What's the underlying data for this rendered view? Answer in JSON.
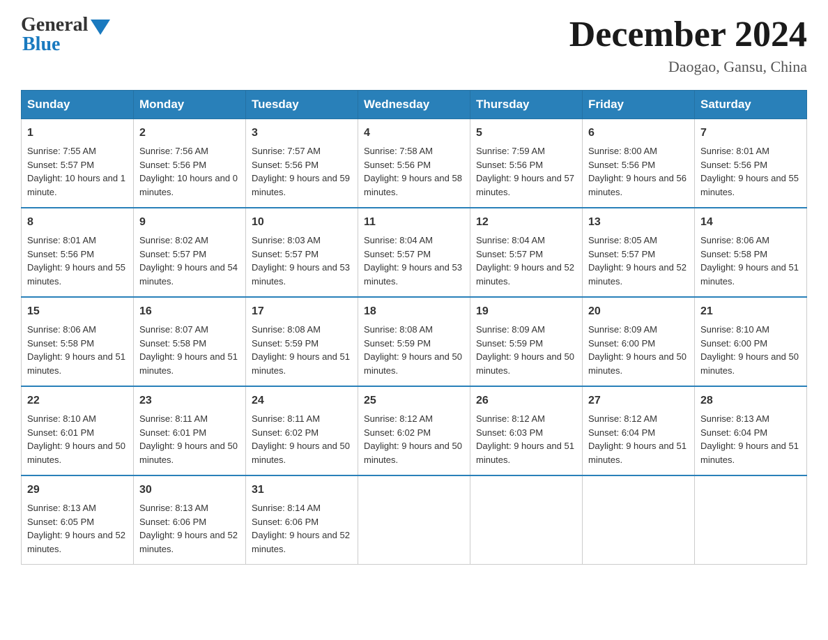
{
  "logo": {
    "general": "General",
    "blue": "Blue"
  },
  "title": "December 2024",
  "location": "Daogao, Gansu, China",
  "days_of_week": [
    "Sunday",
    "Monday",
    "Tuesday",
    "Wednesday",
    "Thursday",
    "Friday",
    "Saturday"
  ],
  "weeks": [
    [
      {
        "day": "1",
        "sunrise": "7:55 AM",
        "sunset": "5:57 PM",
        "daylight": "10 hours and 1 minute."
      },
      {
        "day": "2",
        "sunrise": "7:56 AM",
        "sunset": "5:56 PM",
        "daylight": "10 hours and 0 minutes."
      },
      {
        "day": "3",
        "sunrise": "7:57 AM",
        "sunset": "5:56 PM",
        "daylight": "9 hours and 59 minutes."
      },
      {
        "day": "4",
        "sunrise": "7:58 AM",
        "sunset": "5:56 PM",
        "daylight": "9 hours and 58 minutes."
      },
      {
        "day": "5",
        "sunrise": "7:59 AM",
        "sunset": "5:56 PM",
        "daylight": "9 hours and 57 minutes."
      },
      {
        "day": "6",
        "sunrise": "8:00 AM",
        "sunset": "5:56 PM",
        "daylight": "9 hours and 56 minutes."
      },
      {
        "day": "7",
        "sunrise": "8:01 AM",
        "sunset": "5:56 PM",
        "daylight": "9 hours and 55 minutes."
      }
    ],
    [
      {
        "day": "8",
        "sunrise": "8:01 AM",
        "sunset": "5:56 PM",
        "daylight": "9 hours and 55 minutes."
      },
      {
        "day": "9",
        "sunrise": "8:02 AM",
        "sunset": "5:57 PM",
        "daylight": "9 hours and 54 minutes."
      },
      {
        "day": "10",
        "sunrise": "8:03 AM",
        "sunset": "5:57 PM",
        "daylight": "9 hours and 53 minutes."
      },
      {
        "day": "11",
        "sunrise": "8:04 AM",
        "sunset": "5:57 PM",
        "daylight": "9 hours and 53 minutes."
      },
      {
        "day": "12",
        "sunrise": "8:04 AM",
        "sunset": "5:57 PM",
        "daylight": "9 hours and 52 minutes."
      },
      {
        "day": "13",
        "sunrise": "8:05 AM",
        "sunset": "5:57 PM",
        "daylight": "9 hours and 52 minutes."
      },
      {
        "day": "14",
        "sunrise": "8:06 AM",
        "sunset": "5:58 PM",
        "daylight": "9 hours and 51 minutes."
      }
    ],
    [
      {
        "day": "15",
        "sunrise": "8:06 AM",
        "sunset": "5:58 PM",
        "daylight": "9 hours and 51 minutes."
      },
      {
        "day": "16",
        "sunrise": "8:07 AM",
        "sunset": "5:58 PM",
        "daylight": "9 hours and 51 minutes."
      },
      {
        "day": "17",
        "sunrise": "8:08 AM",
        "sunset": "5:59 PM",
        "daylight": "9 hours and 51 minutes."
      },
      {
        "day": "18",
        "sunrise": "8:08 AM",
        "sunset": "5:59 PM",
        "daylight": "9 hours and 50 minutes."
      },
      {
        "day": "19",
        "sunrise": "8:09 AM",
        "sunset": "5:59 PM",
        "daylight": "9 hours and 50 minutes."
      },
      {
        "day": "20",
        "sunrise": "8:09 AM",
        "sunset": "6:00 PM",
        "daylight": "9 hours and 50 minutes."
      },
      {
        "day": "21",
        "sunrise": "8:10 AM",
        "sunset": "6:00 PM",
        "daylight": "9 hours and 50 minutes."
      }
    ],
    [
      {
        "day": "22",
        "sunrise": "8:10 AM",
        "sunset": "6:01 PM",
        "daylight": "9 hours and 50 minutes."
      },
      {
        "day": "23",
        "sunrise": "8:11 AM",
        "sunset": "6:01 PM",
        "daylight": "9 hours and 50 minutes."
      },
      {
        "day": "24",
        "sunrise": "8:11 AM",
        "sunset": "6:02 PM",
        "daylight": "9 hours and 50 minutes."
      },
      {
        "day": "25",
        "sunrise": "8:12 AM",
        "sunset": "6:02 PM",
        "daylight": "9 hours and 50 minutes."
      },
      {
        "day": "26",
        "sunrise": "8:12 AM",
        "sunset": "6:03 PM",
        "daylight": "9 hours and 51 minutes."
      },
      {
        "day": "27",
        "sunrise": "8:12 AM",
        "sunset": "6:04 PM",
        "daylight": "9 hours and 51 minutes."
      },
      {
        "day": "28",
        "sunrise": "8:13 AM",
        "sunset": "6:04 PM",
        "daylight": "9 hours and 51 minutes."
      }
    ],
    [
      {
        "day": "29",
        "sunrise": "8:13 AM",
        "sunset": "6:05 PM",
        "daylight": "9 hours and 52 minutes."
      },
      {
        "day": "30",
        "sunrise": "8:13 AM",
        "sunset": "6:06 PM",
        "daylight": "9 hours and 52 minutes."
      },
      {
        "day": "31",
        "sunrise": "8:14 AM",
        "sunset": "6:06 PM",
        "daylight": "9 hours and 52 minutes."
      },
      null,
      null,
      null,
      null
    ]
  ],
  "cell_labels": {
    "sunrise": "Sunrise:",
    "sunset": "Sunset:",
    "daylight": "Daylight:"
  }
}
